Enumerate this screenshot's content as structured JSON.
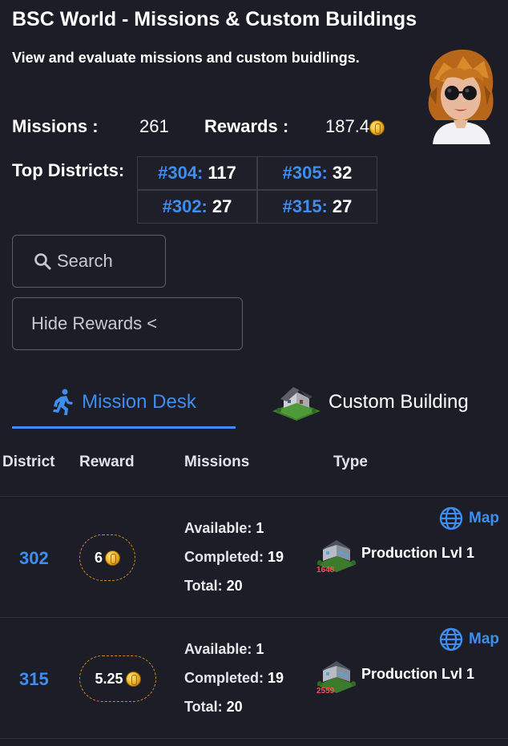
{
  "header": {
    "title": "BSC World - Missions & Custom Buildings",
    "subtitle": "View and evaluate missions and custom buidlings."
  },
  "stats": {
    "missions_label": "Missions :",
    "missions_value": "261",
    "rewards_label": "Rewards :",
    "rewards_value": "187.4"
  },
  "top_districts": {
    "label": "Top Districts:",
    "items": [
      {
        "id": "#304:",
        "count": "117"
      },
      {
        "id": "#305:",
        "count": "32"
      },
      {
        "id": "#302:",
        "count": "27"
      },
      {
        "id": "#315:",
        "count": "27"
      }
    ]
  },
  "controls": {
    "search_label": "Search",
    "hide_rewards_label": "Hide Rewards <"
  },
  "tabs": {
    "mission_desk": "Mission Desk",
    "custom_building": "Custom Building",
    "active": "mission_desk"
  },
  "table": {
    "headers": {
      "district": "District",
      "reward": "Reward",
      "missions": "Missions",
      "type": "Type"
    },
    "rows": [
      {
        "district": "302",
        "reward": "6",
        "available_label": "Available:",
        "available": "1",
        "completed_label": "Completed:",
        "completed": "19",
        "total_label": "Total:",
        "total": "20",
        "building_badge": "1648",
        "type": "Production Lvl 1",
        "map_label": "Map"
      },
      {
        "district": "315",
        "reward": "5.25",
        "available_label": "Available:",
        "available": "1",
        "completed_label": "Completed:",
        "completed": "19",
        "total_label": "Total:",
        "total": "20",
        "building_badge": "2559",
        "type": "Production Lvl 1",
        "map_label": "Map"
      }
    ]
  },
  "colors": {
    "background": "#1c1d26",
    "accent_blue": "#3d8ef0",
    "coin_gold": "#f3b82a",
    "reward_border": "#d48a1d",
    "badge_red": "#ff4d57"
  },
  "icons": {
    "search": "search-icon",
    "runner": "running-person-icon",
    "house": "house-icon",
    "globe": "globe-icon",
    "coin": "coin-icon"
  }
}
